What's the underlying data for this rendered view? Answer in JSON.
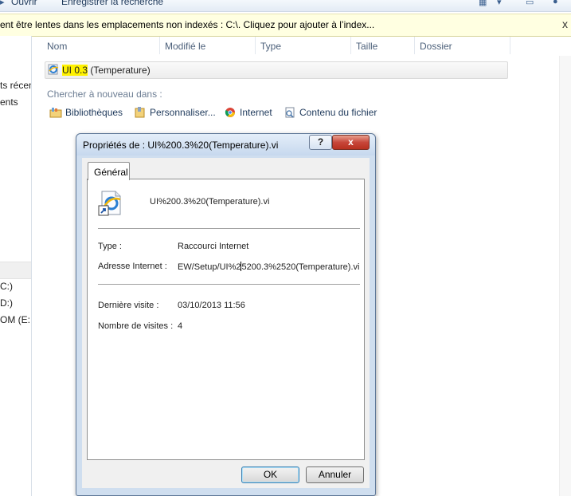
{
  "toolbar": {
    "open_label": "Ouvrir",
    "save_search_label": "Enregistrer la recherche"
  },
  "infobar": {
    "message": "ent être lentes dans les emplacements non indexés : C:\\. Cliquez pour ajouter à l’index...",
    "close_glyph": "x"
  },
  "nav": {
    "items": [
      "ts récen",
      "ents",
      "C:)",
      "D:)",
      "OM (E:"
    ]
  },
  "columns": [
    "Nom",
    "Modifié le",
    "Type",
    "Taille",
    "Dossier"
  ],
  "result": {
    "name_highlight": "UI 0.3",
    "name_rest": " (Temperature)"
  },
  "search_again": {
    "label": "Chercher à nouveau dans :",
    "links": [
      "Bibliothèques",
      "Personnaliser...",
      "Internet",
      "Contenu du fichier"
    ]
  },
  "dialog": {
    "title": "Propriétés de : UI%200.3%20(Temperature).vi",
    "help_glyph": "?",
    "close_glyph": "x",
    "tab_label": "Général",
    "file_name": "UI%200.3%20(Temperature).vi",
    "type_key": "Type :",
    "type_value": "Raccourci Internet",
    "url_key": "Adresse Internet :",
    "url_value_a": "EW/Setup/UI%2",
    "url_value_b": "5200.3%2520(Temperature).vi",
    "last_visit_key": "Dernière visite :",
    "last_visit_value": "03/10/2013 11:56",
    "visits_key": "Nombre de visites :",
    "visits_value": "4",
    "ok_label": "OK",
    "cancel_label": "Annuler"
  },
  "colors": {
    "infobar_bg": "#ffffe1",
    "highlight": "#fff200",
    "close_red": "#c7463a"
  }
}
